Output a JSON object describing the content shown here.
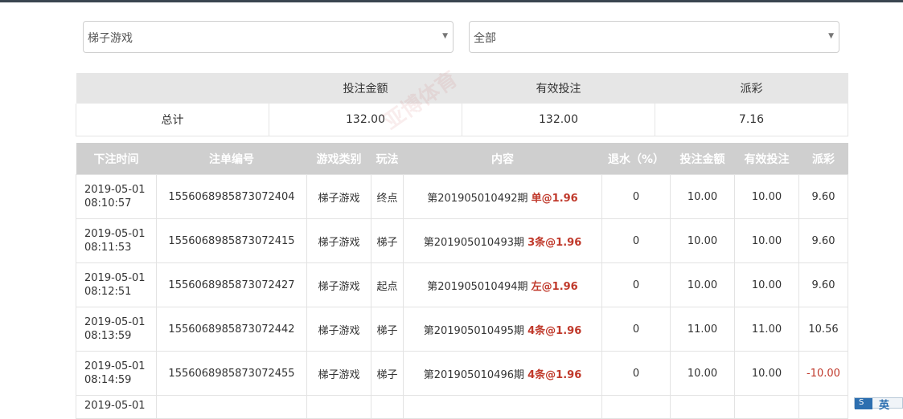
{
  "filters": {
    "game": {
      "value": "梯子游戏",
      "caret": "▼"
    },
    "status": {
      "value": "全部",
      "caret": "▼"
    }
  },
  "summary": {
    "headers": [
      "",
      "投注金额",
      "有效投注",
      "派彩"
    ],
    "row": [
      "总计",
      "132.00",
      "132.00",
      "7.16"
    ]
  },
  "watermark": "亚博体育",
  "details": {
    "headers": [
      "下注时间",
      "注单编号",
      "游戏类别",
      "玩法",
      "内容",
      "退水（%）",
      "投注金额",
      "有效投注",
      "派彩"
    ],
    "rows": [
      {
        "date": "2019-05-01",
        "time": "08:10:57",
        "id": "1556068985873072404",
        "category": "梯子游戏",
        "play": "终点",
        "period": "第201905010492期",
        "pick": "单@1.96",
        "rebate": "0",
        "bet": "10.00",
        "valid": "10.00",
        "payout": "9.60"
      },
      {
        "date": "2019-05-01",
        "time": "08:11:53",
        "id": "1556068985873072415",
        "category": "梯子游戏",
        "play": "梯子",
        "period": "第201905010493期",
        "pick": "3条@1.96",
        "rebate": "0",
        "bet": "10.00",
        "valid": "10.00",
        "payout": "9.60"
      },
      {
        "date": "2019-05-01",
        "time": "08:12:51",
        "id": "1556068985873072427",
        "category": "梯子游戏",
        "play": "起点",
        "period": "第201905010494期",
        "pick": "左@1.96",
        "rebate": "0",
        "bet": "10.00",
        "valid": "10.00",
        "payout": "9.60"
      },
      {
        "date": "2019-05-01",
        "time": "08:13:59",
        "id": "1556068985873072442",
        "category": "梯子游戏",
        "play": "梯子",
        "period": "第201905010495期",
        "pick": "4条@1.96",
        "rebate": "0",
        "bet": "11.00",
        "valid": "11.00",
        "payout": "10.56"
      },
      {
        "date": "2019-05-01",
        "time": "08:14:59",
        "id": "1556068985873072455",
        "category": "梯子游戏",
        "play": "梯子",
        "period": "第201905010496期",
        "pick": "4条@1.96",
        "rebate": "0",
        "bet": "10.00",
        "valid": "10.00",
        "payout": "-10.00"
      }
    ],
    "partial_row": {
      "date": "2019-05-01"
    }
  },
  "ime": {
    "lang": "英"
  },
  "colors": {
    "header_bg": "#cfcfcf",
    "summary_head_bg": "#e6e6e6",
    "pick": "#c0392b",
    "negative": "#c0392b",
    "topbar": "#3a4550"
  }
}
